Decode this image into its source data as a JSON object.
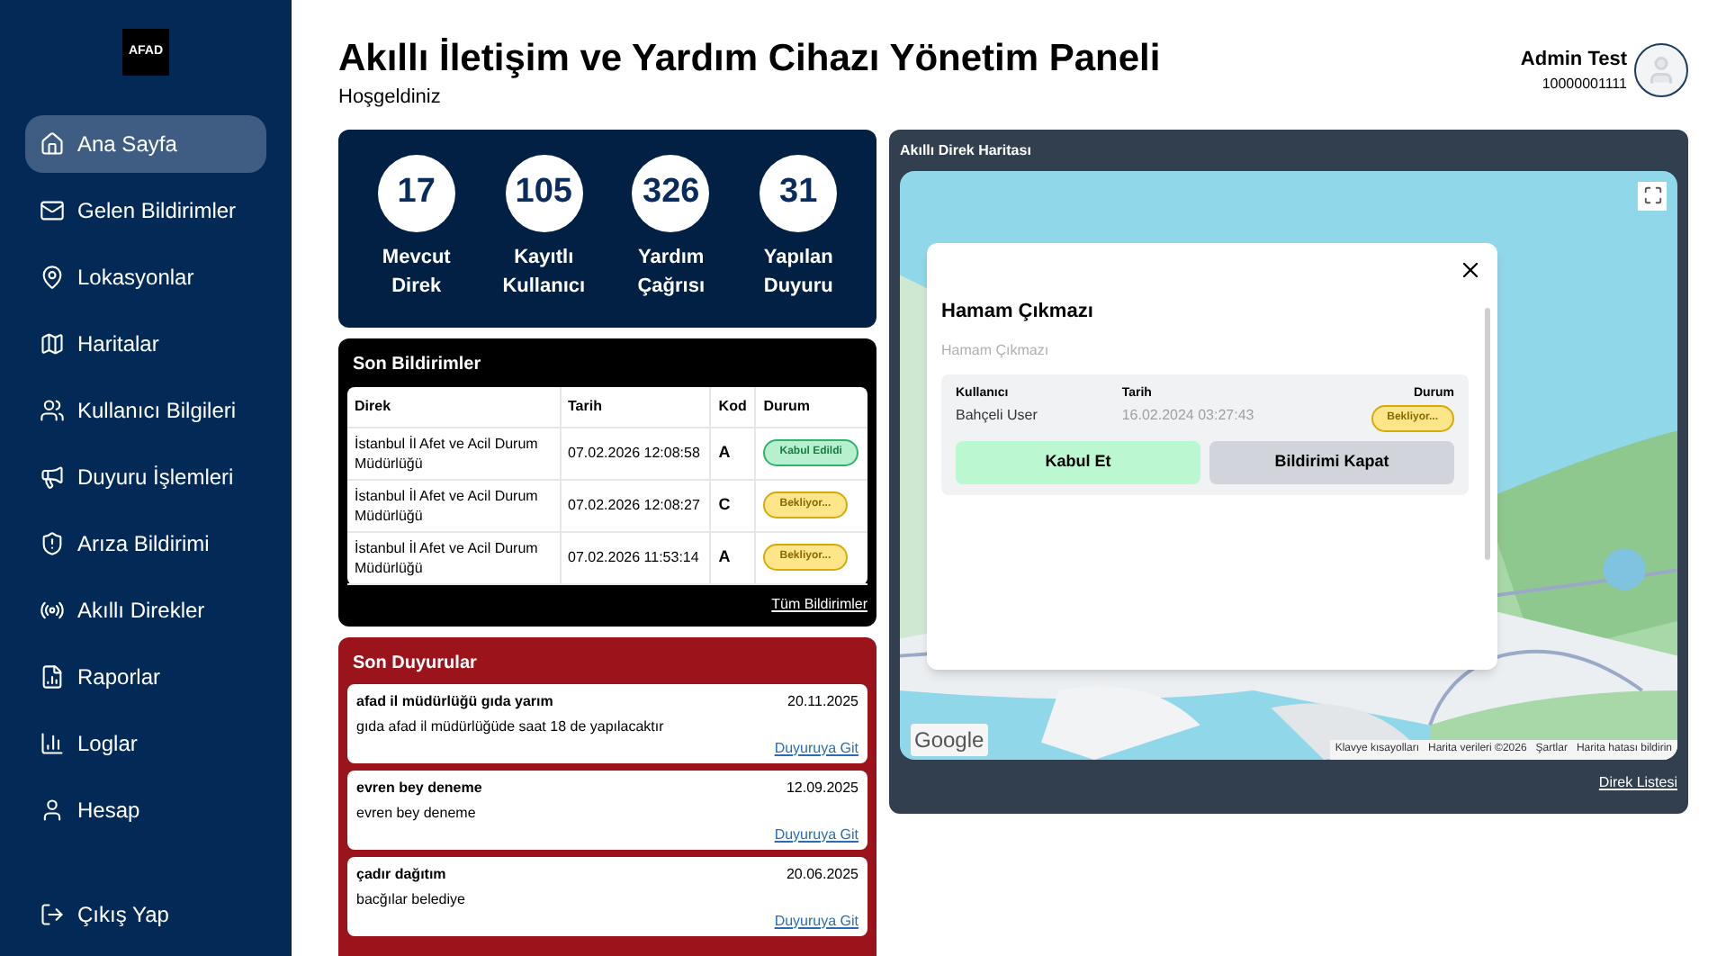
{
  "sidebar": {
    "logo": "AFAD",
    "items": [
      {
        "label": "Ana Sayfa",
        "selected": true
      },
      {
        "label": "Gelen Bildirimler",
        "selected": false
      },
      {
        "label": "Lokasyonlar",
        "selected": false
      },
      {
        "label": "Haritalar",
        "selected": false
      },
      {
        "label": "Kullanıcı Bilgileri",
        "selected": false
      },
      {
        "label": "Duyuru İşlemleri",
        "selected": false
      },
      {
        "label": "Arıza Bildirimi",
        "selected": false
      },
      {
        "label": "Akıllı Direkler",
        "selected": false
      },
      {
        "label": "Raporlar",
        "selected": false
      },
      {
        "label": "Loglar",
        "selected": false
      },
      {
        "label": "Hesap",
        "selected": false
      }
    ],
    "logout": "Çıkış Yap"
  },
  "header": {
    "title": "Akıllı İletişim ve Yardım Cihazı Yönetim Paneli",
    "subtitle": "Hoşgeldiniz",
    "user": {
      "name": "Admin Test",
      "id": "10000001111"
    }
  },
  "stats": [
    {
      "value": "17",
      "label": "Mevcut Direk"
    },
    {
      "value": "105",
      "label": "Kayıtlı Kullanıcı"
    },
    {
      "value": "326",
      "label": "Yardım Çağrısı"
    },
    {
      "value": "31",
      "label": "Yapılan Duyuru"
    }
  ],
  "notifications": {
    "title": "Son Bildirimler",
    "columns": [
      "Direk",
      "Tarih",
      "Kod",
      "Durum"
    ],
    "rows": [
      {
        "direk": "İstanbul İl Afet ve Acil Durum Müdürlüğü",
        "tarih": "07.02.2026 12:08:58",
        "kod": "A",
        "durum": "Kabul Edildi",
        "kind": "accepted"
      },
      {
        "direk": "İstanbul İl Afet ve Acil Durum Müdürlüğü",
        "tarih": "07.02.2026 12:08:27",
        "kod": "C",
        "durum": "Bekliyor...",
        "kind": "pending"
      },
      {
        "direk": "İstanbul İl Afet ve Acil Durum Müdürlüğü",
        "tarih": "07.02.2026 11:53:14",
        "kod": "A",
        "durum": "Bekliyor...",
        "kind": "pending"
      }
    ],
    "link": "Tüm Bildirimler"
  },
  "announcements": {
    "title": "Son Duyurular",
    "items": [
      {
        "title": "afad il müdürlüğü gıda yarım",
        "date": "20.11.2025",
        "body": "gıda afad il müdürlüğüde saat 18 de yapılacaktır",
        "link": "Duyuruya Git"
      },
      {
        "title": "evren bey deneme",
        "date": "12.09.2025",
        "body": "evren bey deneme",
        "link": "Duyuruya Git"
      },
      {
        "title": "çadır dağıtım",
        "date": "20.06.2025",
        "body": "bacğılar belediye",
        "link": "Duyuruya Git"
      }
    ]
  },
  "map": {
    "title": "Akıllı Direk Haritası",
    "popup": {
      "title": "Hamam Çıkmazı",
      "subtitle": "Hamam Çıkmazı",
      "fields": [
        {
          "label": "Kullanıcı",
          "value": "Bahçeli User",
          "kind": "text"
        },
        {
          "label": "Tarih",
          "value": "16.02.2024 03:27:43",
          "kind": "muted"
        },
        {
          "label": "Durum",
          "value": "Bekliyor...",
          "kind": "badge"
        }
      ],
      "buttons": [
        {
          "label": "Kabul Et",
          "kind": "accept"
        },
        {
          "label": "Bildirimi Kapat",
          "kind": "close"
        }
      ]
    },
    "attribution": [
      "Klavye kısayolları",
      "Harita verileri ©2026",
      "Şartlar",
      "Harita hatası bildirin"
    ],
    "brand": "Google",
    "link": "Direk Listesi"
  }
}
